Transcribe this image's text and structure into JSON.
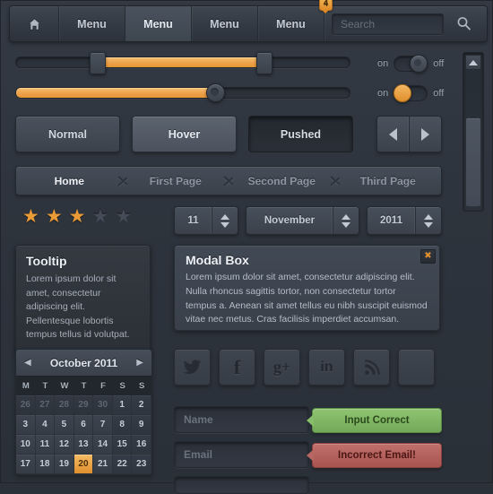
{
  "topbar": {
    "home_icon": "home-icon",
    "menus": [
      {
        "label": "Menu",
        "active": false
      },
      {
        "label": "Menu",
        "active": true
      },
      {
        "label": "Menu",
        "active": false
      },
      {
        "label": "Menu",
        "active": false
      }
    ],
    "badge": "4",
    "search": {
      "placeholder": "Search",
      "value": "",
      "icon": "search-icon"
    }
  },
  "sliders": [
    {
      "name": "range-slider",
      "start_pct": 24,
      "end_pct": 74
    },
    {
      "name": "value-slider",
      "value_pct": 60
    }
  ],
  "toggles": [
    {
      "on_label": "on",
      "off_label": "off",
      "state": "off"
    },
    {
      "on_label": "on",
      "off_label": "off",
      "state": "on"
    }
  ],
  "buttons": {
    "normal": "Normal",
    "hover": "Hover",
    "pushed": "Pushed",
    "prev_icon": "arrow-left-icon",
    "next_icon": "arrow-right-icon"
  },
  "breadcrumb": [
    {
      "label": "Home",
      "active": true
    },
    {
      "label": "First Page",
      "active": false
    },
    {
      "label": "Second Page",
      "active": false
    },
    {
      "label": "Third Page",
      "active": false
    }
  ],
  "rating": {
    "filled": 3,
    "total": 5,
    "glyph": "★"
  },
  "steppers": [
    {
      "name": "day-stepper",
      "value": "11"
    },
    {
      "name": "month-stepper",
      "value": "November"
    },
    {
      "name": "year-stepper",
      "value": "2011"
    }
  ],
  "tooltip": {
    "title": "Tooltip",
    "body": "Lorem ipsum dolor sit amet, consectetur adipiscing elit. Pellentesque lobortis tempus tellus id volutpat."
  },
  "modal": {
    "title": "Modal Box",
    "body": "Lorem ipsum dolor sit amet, consectetur adipiscing elit. Nulla rhoncus sagittis tortor, non consectetur tortor tempus a. Aenean sit amet tellus eu nibh suscipit euismod vitae nec metus. Cras facilisis imperdiet accumsan.",
    "close_label": "✖"
  },
  "calendar": {
    "title": "October 2011",
    "prev_icon": "chevron-left-icon",
    "next_icon": "chevron-right-icon",
    "dow": [
      "M",
      "T",
      "W",
      "T",
      "F",
      "S",
      "S"
    ],
    "selected_day": "20",
    "weeks": [
      [
        {
          "d": "26",
          "mute": true
        },
        {
          "d": "27",
          "mute": true
        },
        {
          "d": "28",
          "mute": true
        },
        {
          "d": "29",
          "mute": true
        },
        {
          "d": "30",
          "mute": true
        },
        {
          "d": "1",
          "wknd": true
        },
        {
          "d": "2",
          "wknd": true
        }
      ],
      [
        {
          "d": "3"
        },
        {
          "d": "4"
        },
        {
          "d": "5"
        },
        {
          "d": "6"
        },
        {
          "d": "7"
        },
        {
          "d": "8",
          "wknd": true
        },
        {
          "d": "9",
          "wknd": true
        }
      ],
      [
        {
          "d": "10"
        },
        {
          "d": "11"
        },
        {
          "d": "12"
        },
        {
          "d": "13"
        },
        {
          "d": "14"
        },
        {
          "d": "15",
          "wknd": true
        },
        {
          "d": "16",
          "wknd": true
        }
      ],
      [
        {
          "d": "17"
        },
        {
          "d": "18"
        },
        {
          "d": "19"
        },
        {
          "d": "20",
          "sel": true
        },
        {
          "d": "21"
        },
        {
          "d": "22",
          "wknd": true
        },
        {
          "d": "23",
          "wknd": true
        }
      ]
    ]
  },
  "social": [
    {
      "name": "twitter-icon",
      "glyph": "🐦"
    },
    {
      "name": "facebook-icon",
      "glyph": "f"
    },
    {
      "name": "googleplus-icon",
      "glyph": "g+"
    },
    {
      "name": "linkedin-icon",
      "glyph": "in"
    },
    {
      "name": "rss-icon",
      "glyph": "◢"
    },
    {
      "name": "blank-icon",
      "glyph": ""
    }
  ],
  "form": {
    "name_placeholder": "Name",
    "name_value": "",
    "email_placeholder": "Email",
    "email_value": "",
    "success_message": "Input Correct",
    "error_message": "Incorrect Email!"
  },
  "scrollbar": {
    "up_icon": "triangle-up-icon"
  },
  "colors": {
    "accent": "#eb9b36",
    "background": "#2e343d",
    "panel": "#3a414b",
    "success": "#7eb661",
    "error": "#b35e5a"
  }
}
